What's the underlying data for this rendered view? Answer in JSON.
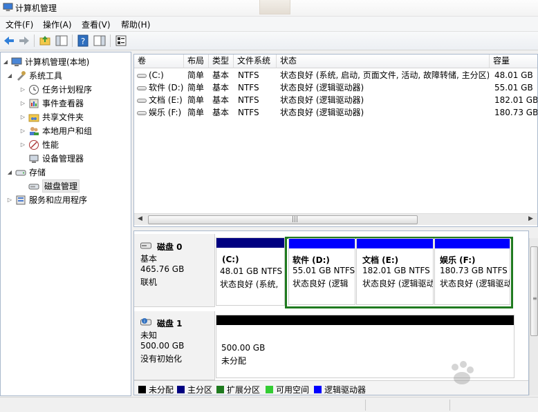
{
  "window": {
    "title": "计算机管理"
  },
  "menu": [
    "文件(F)",
    "操作(A)",
    "查看(V)",
    "帮助(H)"
  ],
  "toolbar": [
    "back-icon",
    "forward-icon",
    "up-folder-icon",
    "show-hide-tree-icon",
    "help-icon",
    "show-hide-action-pane-icon",
    "properties-icon"
  ],
  "tree": [
    {
      "label": "计算机管理(本地)",
      "icon": "computer-management-icon",
      "level": 0
    },
    {
      "label": "系统工具",
      "icon": "tools-icon",
      "level": 1
    },
    {
      "label": "任务计划程序",
      "icon": "task-scheduler-icon",
      "level": 2
    },
    {
      "label": "事件查看器",
      "icon": "event-viewer-icon",
      "level": 2
    },
    {
      "label": "共享文件夹",
      "icon": "shared-folder-icon",
      "level": 2
    },
    {
      "label": "本地用户和组",
      "icon": "users-icon",
      "level": 2
    },
    {
      "label": "性能",
      "icon": "performance-icon",
      "level": 2
    },
    {
      "label": "设备管理器",
      "icon": "device-manager-icon",
      "level": 2
    },
    {
      "label": "存储",
      "icon": "storage-icon",
      "level": 1
    },
    {
      "label": "磁盘管理",
      "icon": "disk-management-icon",
      "level": 2,
      "selected": true
    },
    {
      "label": "服务和应用程序",
      "icon": "services-icon",
      "level": 1
    }
  ],
  "volumes": {
    "columns": [
      "卷",
      "布局",
      "类型",
      "文件系统",
      "状态",
      "容量"
    ],
    "rows": [
      [
        "(C:)",
        "简单",
        "基本",
        "NTFS",
        "状态良好 (系统, 启动, 页面文件, 活动, 故障转储, 主分区)",
        "48.01 GB"
      ],
      [
        "软件 (D:)",
        "简单",
        "基本",
        "NTFS",
        "状态良好 (逻辑驱动器)",
        "55.01 GB"
      ],
      [
        "文档 (E:)",
        "简单",
        "基本",
        "NTFS",
        "状态良好 (逻辑驱动器)",
        "182.01 GB"
      ],
      [
        "娱乐 (F:)",
        "简单",
        "基本",
        "NTFS",
        "状态良好 (逻辑驱动器)",
        "180.73 GB"
      ]
    ]
  },
  "disks": [
    {
      "name": "磁盘 0",
      "type": "基本",
      "size": "465.76 GB",
      "status": "联机",
      "partitions": [
        {
          "label": "(C:)",
          "size": "48.01 GB NTFS",
          "status": "状态良好 (系统,",
          "kind": "primary"
        },
        {
          "label": "软件  (D:)",
          "size": "55.01 GB NTFS",
          "status": "状态良好 (逻辑",
          "kind": "logical"
        },
        {
          "label": "文档  (E:)",
          "size": "182.01 GB NTFS",
          "status": "状态良好 (逻辑驱动",
          "kind": "logical"
        },
        {
          "label": "娱乐  (F:)",
          "size": "180.73 GB NTFS",
          "status": "状态良好 (逻辑驱动",
          "kind": "logical"
        }
      ]
    },
    {
      "name": "磁盘 1",
      "type": "未知",
      "size": "500.00 GB",
      "status": "没有初始化",
      "partitions": [
        {
          "label": "",
          "size": "500.00 GB",
          "status": "未分配",
          "kind": "unallocated"
        }
      ]
    }
  ],
  "legend": [
    {
      "label": "未分配",
      "color": "#000000"
    },
    {
      "label": "主分区",
      "color": "#000080"
    },
    {
      "label": "扩展分区",
      "color": "#1f7a1f"
    },
    {
      "label": "可用空间",
      "color": "#33cc33"
    },
    {
      "label": "逻辑驱动器",
      "color": "#0000ff"
    }
  ],
  "colors": {
    "primary": "#000080",
    "logical": "#0000ff",
    "unallocated": "#000000",
    "extended": "#1f7a1f"
  }
}
